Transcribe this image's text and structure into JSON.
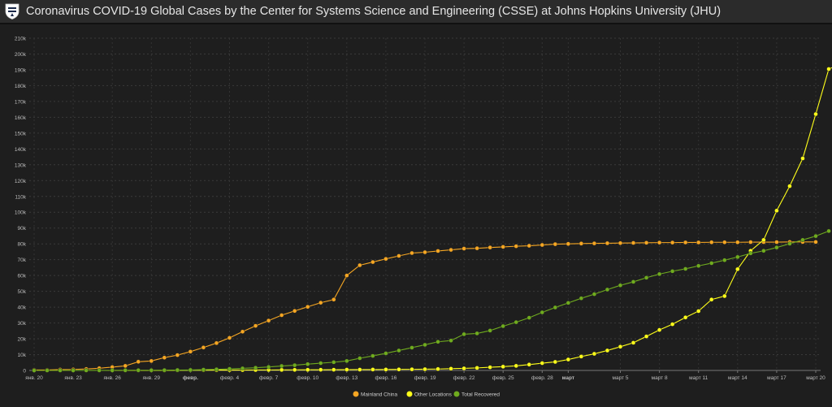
{
  "header": {
    "title": "Coronavirus COVID-19 Global Cases by the Center for Systems Science and Engineering (CSSE) at Johns Hopkins University (JHU)"
  },
  "chart_data": {
    "type": "line",
    "ylim": [
      0,
      210000
    ],
    "y_ticks": [
      {
        "v": 0,
        "label": "0"
      },
      {
        "v": 10000,
        "label": "10k"
      },
      {
        "v": 20000,
        "label": "20k"
      },
      {
        "v": 30000,
        "label": "30k"
      },
      {
        "v": 40000,
        "label": "40k"
      },
      {
        "v": 50000,
        "label": "50k"
      },
      {
        "v": 60000,
        "label": "60k"
      },
      {
        "v": 70000,
        "label": "70k"
      },
      {
        "v": 80000,
        "label": "80k"
      },
      {
        "v": 90000,
        "label": "90k"
      },
      {
        "v": 100000,
        "label": "100k"
      },
      {
        "v": 110000,
        "label": "110k"
      },
      {
        "v": 120000,
        "label": "120k"
      },
      {
        "v": 130000,
        "label": "130k"
      },
      {
        "v": 140000,
        "label": "140k"
      },
      {
        "v": 150000,
        "label": "150k"
      },
      {
        "v": 160000,
        "label": "160k"
      },
      {
        "v": 170000,
        "label": "170k"
      },
      {
        "v": 180000,
        "label": "180k"
      },
      {
        "v": 190000,
        "label": "190k"
      },
      {
        "v": 200000,
        "label": "200k"
      },
      {
        "v": 210000,
        "label": "210k"
      }
    ],
    "x_dates": [
      "2020-01-20",
      "2020-01-21",
      "2020-01-22",
      "2020-01-23",
      "2020-01-24",
      "2020-01-25",
      "2020-01-26",
      "2020-01-27",
      "2020-01-28",
      "2020-01-29",
      "2020-01-30",
      "2020-01-31",
      "2020-02-01",
      "2020-02-02",
      "2020-02-03",
      "2020-02-04",
      "2020-02-05",
      "2020-02-06",
      "2020-02-07",
      "2020-02-08",
      "2020-02-09",
      "2020-02-10",
      "2020-02-11",
      "2020-02-12",
      "2020-02-13",
      "2020-02-14",
      "2020-02-15",
      "2020-02-16",
      "2020-02-17",
      "2020-02-18",
      "2020-02-19",
      "2020-02-20",
      "2020-02-21",
      "2020-02-22",
      "2020-02-23",
      "2020-02-24",
      "2020-02-25",
      "2020-02-26",
      "2020-02-27",
      "2020-02-28",
      "2020-02-29",
      "2020-03-01",
      "2020-03-02",
      "2020-03-03",
      "2020-03-04",
      "2020-03-05",
      "2020-03-06",
      "2020-03-07",
      "2020-03-08",
      "2020-03-09",
      "2020-03-10",
      "2020-03-11",
      "2020-03-12",
      "2020-03-13",
      "2020-03-14",
      "2020-03-15",
      "2020-03-16",
      "2020-03-17",
      "2020-03-18",
      "2020-03-19",
      "2020-03-20"
    ],
    "x_ticks": [
      {
        "i": 0,
        "label": "янв. 20",
        "bold": false
      },
      {
        "i": 3,
        "label": "янв. 23",
        "bold": false
      },
      {
        "i": 6,
        "label": "янв. 26",
        "bold": false
      },
      {
        "i": 9,
        "label": "янв. 29",
        "bold": false
      },
      {
        "i": 12,
        "label": "февр.",
        "bold": true
      },
      {
        "i": 15,
        "label": "февр. 4",
        "bold": false
      },
      {
        "i": 18,
        "label": "февр. 7",
        "bold": false
      },
      {
        "i": 21,
        "label": "февр. 10",
        "bold": false
      },
      {
        "i": 24,
        "label": "февр. 13",
        "bold": false
      },
      {
        "i": 27,
        "label": "февр. 16",
        "bold": false
      },
      {
        "i": 30,
        "label": "февр. 19",
        "bold": false
      },
      {
        "i": 33,
        "label": "февр. 22",
        "bold": false
      },
      {
        "i": 36,
        "label": "февр. 25",
        "bold": false
      },
      {
        "i": 39,
        "label": "февр. 28",
        "bold": false
      },
      {
        "i": 41,
        "label": "март",
        "bold": true
      },
      {
        "i": 45,
        "label": "март 5",
        "bold": false
      },
      {
        "i": 48,
        "label": "март 8",
        "bold": false
      },
      {
        "i": 51,
        "label": "март 11",
        "bold": false
      },
      {
        "i": 54,
        "label": "март 14",
        "bold": false
      },
      {
        "i": 57,
        "label": "март 17",
        "bold": false
      },
      {
        "i": 60,
        "label": "март 20",
        "bold": false
      }
    ],
    "series": [
      {
        "name": "Mainland China",
        "color": "#f5a623",
        "start": 0,
        "values": [
          280,
          310,
          550,
          640,
          920,
          1400,
          2100,
          2900,
          5500,
          6000,
          8100,
          9700,
          11900,
          14500,
          17300,
          20600,
          24500,
          28200,
          31500,
          34900,
          37600,
          40200,
          42800,
          44800,
          60000,
          66500,
          68500,
          70500,
          72400,
          74200,
          74700,
          75500,
          76200,
          77000,
          77200,
          77700,
          78100,
          78500,
          78800,
          79300,
          79800,
          80000,
          80200,
          80300,
          80400,
          80500,
          80600,
          80700,
          80800,
          80800,
          80900,
          80900,
          81000,
          81000,
          81000,
          81100,
          81100,
          81100,
          81200,
          81200,
          81200
        ]
      },
      {
        "name": "Other Locations",
        "color": "#ffff1a",
        "start": 1,
        "values": [
          0,
          0,
          0,
          0,
          0,
          0,
          0,
          0,
          0,
          0,
          100,
          150,
          170,
          200,
          230,
          260,
          290,
          320,
          360,
          380,
          410,
          440,
          460,
          500,
          520,
          560,
          600,
          650,
          700,
          790,
          900,
          1100,
          1300,
          1600,
          2000,
          2400,
          2900,
          3700,
          4600,
          5400,
          6900,
          8800,
          10500,
          12600,
          15000,
          17500,
          21500,
          25600,
          29200,
          33500,
          37500,
          44800,
          47000,
          64000,
          75600,
          82500,
          101000,
          116500,
          134000,
          162000,
          190500,
          194000
        ]
      },
      {
        "name": "Total Recovered",
        "color": "#6fab1e",
        "start": 0,
        "values": [
          0,
          0,
          30,
          30,
          40,
          50,
          60,
          100,
          130,
          130,
          170,
          230,
          300,
          500,
          700,
          1000,
          1300,
          1700,
          2200,
          2800,
          3300,
          4000,
          4600,
          5200,
          6000,
          7700,
          9200,
          10800,
          12600,
          14400,
          16200,
          18100,
          18900,
          22900,
          23400,
          25200,
          28000,
          30500,
          33300,
          36700,
          39800,
          42700,
          45600,
          48200,
          51100,
          53800,
          56000,
          58600,
          60900,
          62700,
          64200,
          66100,
          67800,
          69700,
          71700,
          74000,
          75600,
          77700,
          80100,
          82500,
          84900,
          88100
        ]
      }
    ]
  }
}
